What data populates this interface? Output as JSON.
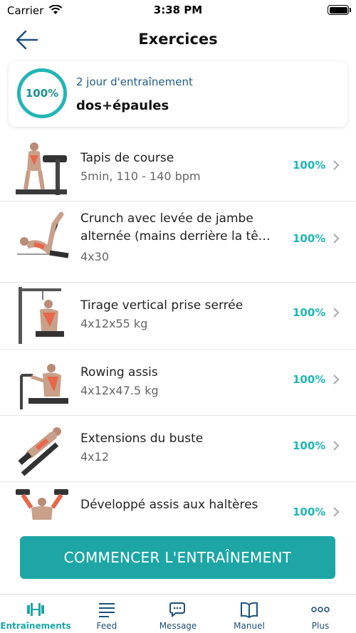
{
  "status": {
    "carrier": "Carrier",
    "time": "3:38 PM"
  },
  "header": {
    "title": "Exercices"
  },
  "summary": {
    "progress": "100%",
    "subtitle": "2 jour d'entraînement",
    "title": "dos+épaules"
  },
  "exercises": [
    {
      "name": "Tapis de course",
      "detail": "5min, 110 - 140 bpm",
      "percent": "100%"
    },
    {
      "name": "Crunch avec levée de jambe alternée (mains derrière la tê…",
      "detail": "4x30",
      "percent": "100%"
    },
    {
      "name": "Tirage vertical prise serrée",
      "detail": "4x12x55 kg",
      "percent": "100%"
    },
    {
      "name": "Rowing assis",
      "detail": "4x12x47.5 kg",
      "percent": "100%"
    },
    {
      "name": "Extensions du buste",
      "detail": "4x12",
      "percent": "100%"
    },
    {
      "name": "Développé assis aux haltères",
      "detail": "",
      "percent": "100%"
    }
  ],
  "start_button": "COMMENCER L'ENTRAÎNEMENT",
  "tabs": [
    {
      "label": "Entraînements",
      "icon": "dumbbell-icon"
    },
    {
      "label": "Feed",
      "icon": "feed-icon"
    },
    {
      "label": "Message",
      "icon": "message-icon"
    },
    {
      "label": "Manuel",
      "icon": "book-icon"
    },
    {
      "label": "Plus",
      "icon": "more-icon"
    }
  ],
  "colors": {
    "accent": "#1ea6a6",
    "ring": "#24b5b5",
    "muscle": "#e8664a",
    "tab_inactive": "#1d4f7a"
  }
}
